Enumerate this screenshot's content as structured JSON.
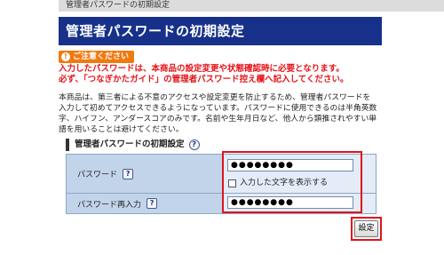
{
  "breadcrumb": "管理者パスワードの初期設定",
  "page_title": "管理者パスワードの初期設定",
  "caution": {
    "badge_label": "ご注意ください",
    "line1": "入力したパスワードは、本商品の設定変更や状態確認時に必要となります。",
    "line2": "必ず、「つなぎかたガイド」の管理者パスワード控え欄へ記入してください。"
  },
  "description": {
    "line1": "本商品は、第三者による不意のアクセスや設定変更を防止するため、管理者パスワードを",
    "line2": "入力して初めてアクセスできるようになっています。パスワードに使用できるのは半角英数",
    "line3": "字、ハイフン、アンダースコアのみです。名前や生年月日など、他人から類推されやすい単",
    "line4": "語を用いることは避けてください。"
  },
  "section": {
    "title": "管理者パスワードの初期設定",
    "help_icon": "?"
  },
  "form": {
    "password_label": "パスワード",
    "password_value": "●●●●●●●●",
    "show_password_label": "入力した文字を表示する",
    "show_password_checked": false,
    "confirm_label": "パスワード再入力",
    "confirm_value": "●●●●●●●●",
    "help_icon": "?"
  },
  "submit_label": "設定",
  "colors": {
    "title_bg": "#17318a",
    "caution_badge": "#f07a12",
    "caution_text": "#e4141a",
    "highlight_box": "#e0141c",
    "label_cell": "#c2d4ea",
    "value_cell": "#e3ecf7"
  }
}
